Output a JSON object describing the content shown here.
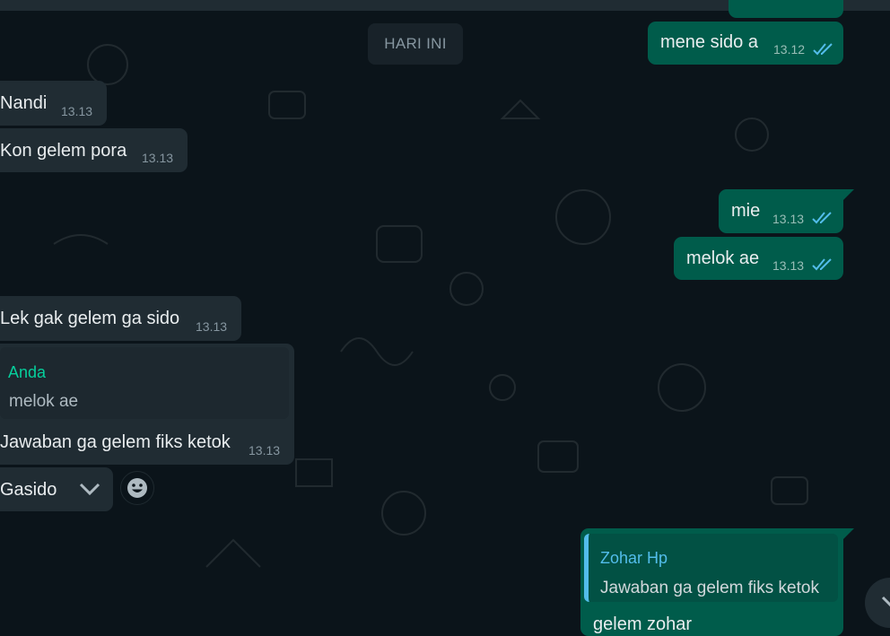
{
  "date_divider": "HARI INI",
  "messages": {
    "m1": {
      "text": "mene sido a",
      "time": "13.12"
    },
    "m2": {
      "text": "Nandi",
      "time": "13.13"
    },
    "m3": {
      "text": "Kon gelem pora",
      "time": "13.13"
    },
    "m4": {
      "text": "mie",
      "time": "13.13"
    },
    "m5": {
      "text": "melok ae",
      "time": "13.13"
    },
    "m6": {
      "text": "Lek gak gelem ga sido",
      "time": "13.13"
    },
    "m7": {
      "quote_author": "Anda",
      "quote_text": "melok ae",
      "text": "Jawaban ga gelem fiks ketok",
      "time": "13.13"
    },
    "m8": {
      "text": "Gasido"
    },
    "m9": {
      "quote_author": "Zohar Hp",
      "quote_text": "Jawaban ga gelem fiks ketok",
      "text": "gelem zohar"
    }
  },
  "icons": {
    "read_receipt": "double-check-icon",
    "message_menu": "chevron-down-icon",
    "reaction": "smiley-icon",
    "scroll_down": "chevron-down-icon"
  },
  "colors": {
    "background": "#0b141a",
    "incoming_bubble": "#202c33",
    "outgoing_bubble": "#005c4b",
    "read_tick": "#53bdeb",
    "quote_author_incoming": "#06cf9c",
    "quote_author_outgoing": "#53bdeb"
  }
}
